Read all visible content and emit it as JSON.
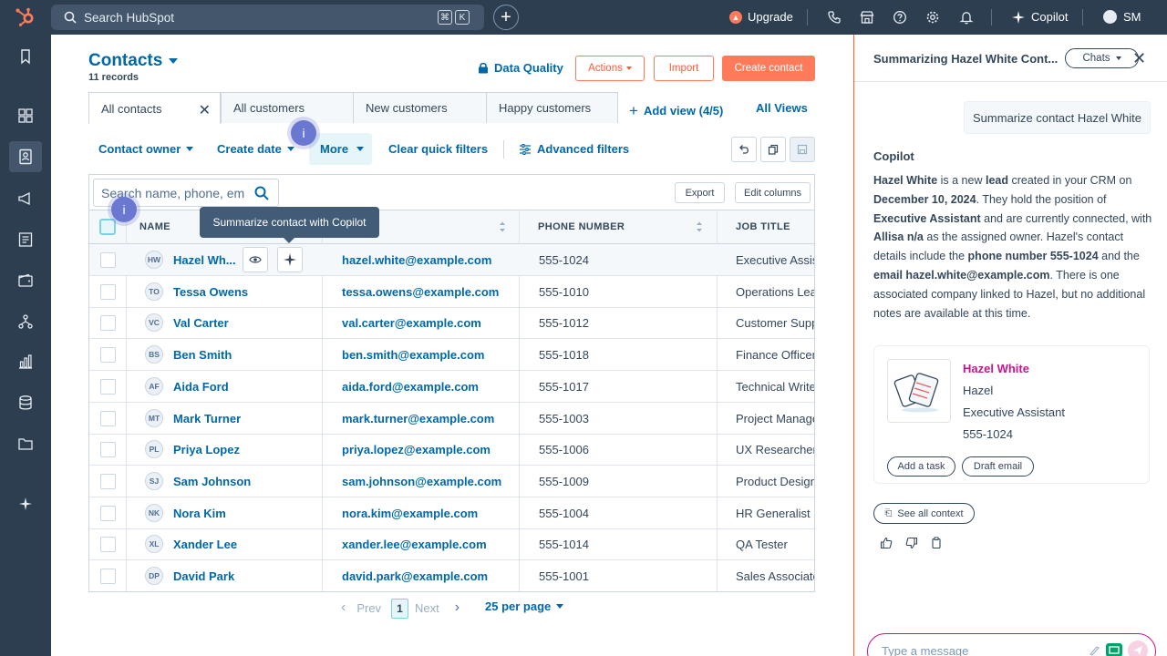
{
  "topbar": {
    "search_placeholder": "Search HubSpot",
    "kbd1": "⌘",
    "kbd2": "K",
    "upgrade": "Upgrade",
    "copilot": "Copilot",
    "account": "SM"
  },
  "header": {
    "title": "Contacts",
    "records": "11 records",
    "data_quality": "Data Quality",
    "actions": "Actions",
    "import": "Import",
    "create": "Create contact"
  },
  "views": {
    "tabs": [
      "All contacts",
      "All customers",
      "New customers",
      "Happy customers"
    ],
    "add_view": "Add view (4/5)",
    "all_views": "All Views"
  },
  "filters": {
    "contact_owner": "Contact owner",
    "create_date": "Create date",
    "more": "More",
    "clear": "Clear quick filters",
    "advanced": "Advanced filters"
  },
  "table": {
    "search_placeholder": "Search name, phone, em",
    "export": "Export",
    "edit_columns": "Edit columns",
    "columns": [
      "NAME",
      "PHONE NUMBER",
      "JOB TITLE"
    ],
    "tooltip": "Summarize contact with Copilot",
    "rows": [
      {
        "initials": "HW",
        "name": "Hazel Wh...",
        "email": "hazel.white@example.com",
        "phone": "555-1024",
        "job": "Executive Assistant"
      },
      {
        "initials": "TO",
        "name": "Tessa Owens",
        "email": "tessa.owens@example.com",
        "phone": "555-1010",
        "job": "Operations Lead"
      },
      {
        "initials": "VC",
        "name": "Val Carter",
        "email": "val.carter@example.com",
        "phone": "555-1012",
        "job": "Customer Support"
      },
      {
        "initials": "BS",
        "name": "Ben Smith",
        "email": "ben.smith@example.com",
        "phone": "555-1018",
        "job": "Finance Officer"
      },
      {
        "initials": "AF",
        "name": "Aida Ford",
        "email": "aida.ford@example.com",
        "phone": "555-1017",
        "job": "Technical Writer"
      },
      {
        "initials": "MT",
        "name": "Mark Turner",
        "email": "mark.turner@example.com",
        "phone": "555-1003",
        "job": "Project Manager"
      },
      {
        "initials": "PL",
        "name": "Priya Lopez",
        "email": "priya.lopez@example.com",
        "phone": "555-1006",
        "job": "UX Researcher"
      },
      {
        "initials": "SJ",
        "name": "Sam Johnson",
        "email": "sam.johnson@example.com",
        "phone": "555-1009",
        "job": "Product Designer"
      },
      {
        "initials": "NK",
        "name": "Nora Kim",
        "email": "nora.kim@example.com",
        "phone": "555-1004",
        "job": "HR Generalist"
      },
      {
        "initials": "XL",
        "name": "Xander Lee",
        "email": "xander.lee@example.com",
        "phone": "555-1014",
        "job": "QA Tester"
      },
      {
        "initials": "DP",
        "name": "David Park",
        "email": "david.park@example.com",
        "phone": "555-1001",
        "job": "Sales Associate"
      }
    ]
  },
  "pagination": {
    "prev": "Prev",
    "page": "1",
    "next": "Next",
    "per_page": "25 per page"
  },
  "copilot": {
    "title": "Summarizing Hazel White Cont...",
    "chats": "Chats",
    "user_message": "Summarize contact Hazel White",
    "label": "Copilot",
    "summary": {
      "p1": "Hazel White",
      "p2": " is a new ",
      "p3": "lead",
      "p4": " created in your CRM on ",
      "p5": "December 10, 2024",
      "p6": ". They hold the position of ",
      "p7": "Executive Assistant",
      "p8": " and are currently connected, with ",
      "p9": "Allisa n/a",
      "p10": " as the assigned owner. Hazel's contact details include the ",
      "p11": "phone number 555-1024",
      "p12": " and the ",
      "p13": "email hazel.white@example.com",
      "p14": ". There is one associated company linked to Hazel, but no additional notes are available at this time."
    },
    "card": {
      "name": "Hazel White",
      "first": "Hazel",
      "job": "Executive Assistant",
      "phone": "555-1024",
      "add_task": "Add a task",
      "draft_email": "Draft email"
    },
    "see_all": "See all context",
    "message_placeholder": "Type a message"
  },
  "colors": {
    "nav": "#2d3e50",
    "link": "#0068a8",
    "accent": "#ff7a59",
    "copilot_pink": "#c3178a"
  }
}
